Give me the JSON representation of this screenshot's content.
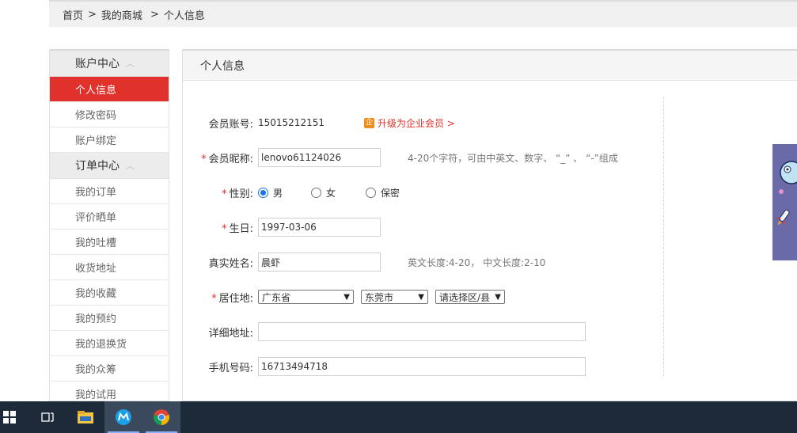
{
  "breadcrumb": {
    "items": [
      "首页",
      "我的商城",
      "个人信息"
    ],
    "separator": ">"
  },
  "sidebar": {
    "groups": [
      {
        "title": "账户中心",
        "items": [
          "个人信息",
          "修改密码",
          "账户绑定"
        ]
      },
      {
        "title": "订单中心",
        "items": [
          "我的订单",
          "评价晒单",
          "我的吐槽",
          "收货地址",
          "我的收藏",
          "我的预约",
          "我的退换货",
          "我的众筹",
          "我的试用"
        ]
      }
    ],
    "active": "个人信息"
  },
  "panel": {
    "title": "个人信息"
  },
  "form": {
    "account": {
      "label": "会员账号:",
      "value": "15015212151",
      "upgrade_icon": "企",
      "upgrade": "升级为企业会员 >"
    },
    "nickname": {
      "required": "*",
      "label": "会员昵称:",
      "value": "lenovo61124026",
      "hint": "4-20个字符，可由中英文、数字、 “_” 、 “-”组成"
    },
    "gender": {
      "required": "*",
      "label": "性别:",
      "options": [
        "男",
        "女",
        "保密"
      ],
      "selected": "男"
    },
    "birthday": {
      "required": "*",
      "label": "生日:",
      "value": "1997-03-06"
    },
    "realname": {
      "label": "真实姓名:",
      "value": "晨虾",
      "hint": "英文长度:4-20， 中文长度:2-10"
    },
    "residence": {
      "required": "*",
      "label": "居住地:",
      "province": "广东省",
      "city": "东莞市",
      "district": "请选择区/县"
    },
    "address": {
      "label": "详细地址:",
      "value": ""
    },
    "phone": {
      "label": "手机号码:",
      "value": "16713494718"
    }
  },
  "colors": {
    "accent": "#e0312a",
    "taskbar": "#1c2a3a",
    "radio_selected": "#1a73e8"
  },
  "taskbar": {
    "icons": [
      "windows-start-icon",
      "task-view-icon",
      "file-explorer-icon",
      "app-m-icon",
      "chrome-icon"
    ]
  }
}
